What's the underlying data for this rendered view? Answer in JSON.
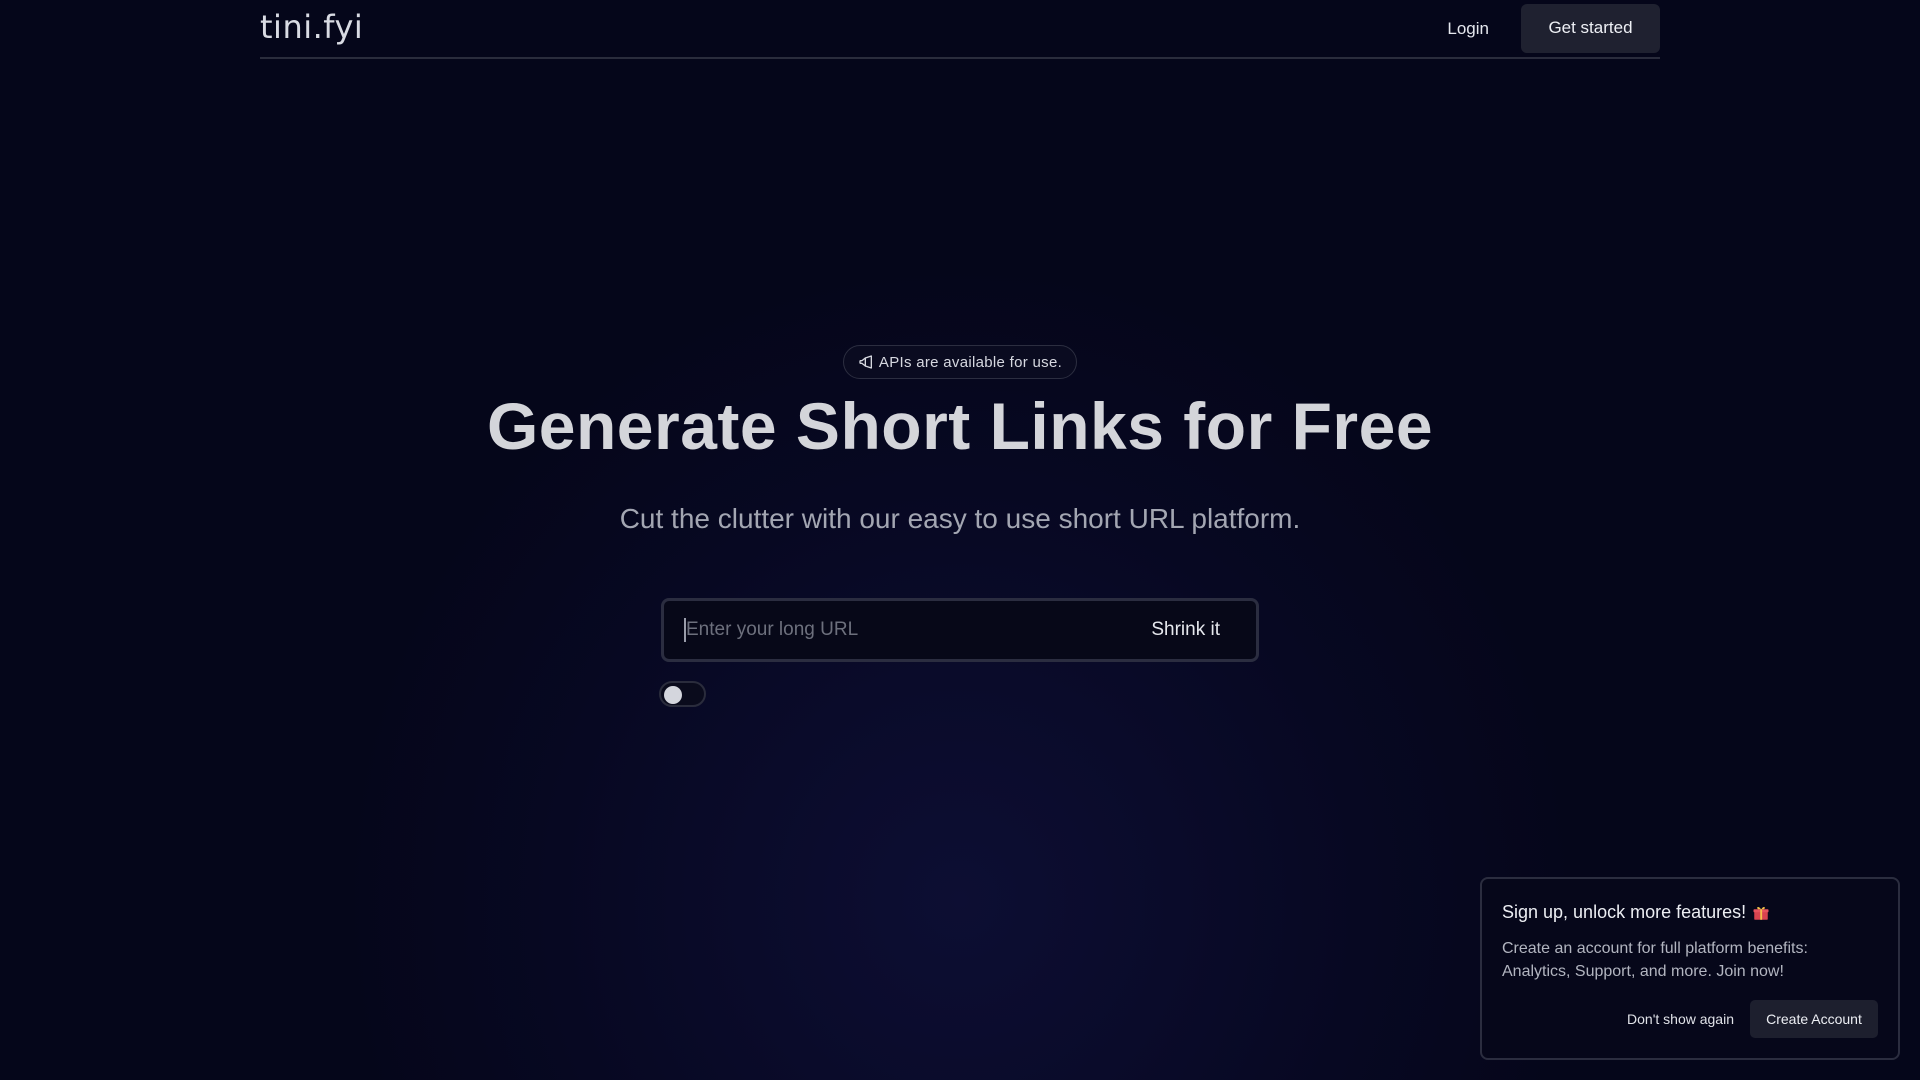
{
  "header": {
    "logo": "tini.fyi",
    "login_label": "Login",
    "get_started_label": "Get started"
  },
  "hero": {
    "badge_icon": "megaphone-icon",
    "badge_text": "APIs are available for use.",
    "title": "Generate Short Links for Free",
    "subtitle": "Cut the clutter with our easy to use short URL platform."
  },
  "shortener": {
    "url_placeholder": "Enter your long URL",
    "url_value": "",
    "submit_label": "Shrink it",
    "toggle_on": false
  },
  "signup_popup": {
    "title": "Sign up, unlock more features!",
    "title_icon": "gift-icon",
    "body": "Create an account for full platform benefits: Analytics, Support, and more. Join now!",
    "dismiss_label": "Don't show again",
    "cta_label": "Create Account"
  },
  "colors": {
    "background": "#05061a",
    "button_bg": "#1f2130",
    "border": "#2b2d40"
  }
}
